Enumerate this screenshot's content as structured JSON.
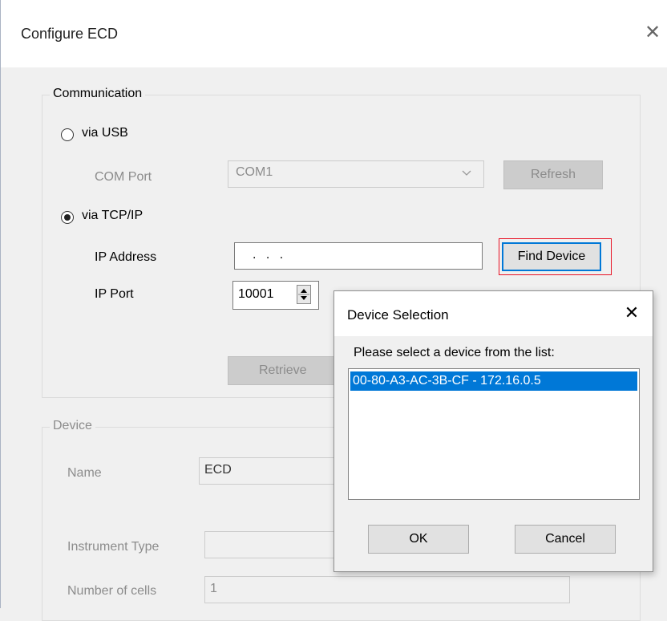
{
  "window": {
    "title": "Configure ECD"
  },
  "communication": {
    "legend": "Communication",
    "via_usb_label": "via USB",
    "com_port_label": "COM Port",
    "com_port_value": "COM1",
    "refresh_label": "Refresh",
    "via_tcpip_label": "via TCP/IP",
    "ip_address_label": "IP Address",
    "ip_address_value": ". . .",
    "find_device_label": "Find Device",
    "ip_port_label": "IP Port",
    "ip_port_value": "10001",
    "retrieve_label": "Retrieve"
  },
  "device": {
    "legend": "Device",
    "name_label": "Name",
    "name_value": "ECD",
    "instrument_type_label": "Instrument Type",
    "instrument_type_value": "",
    "number_of_cells_label": "Number of cells",
    "number_of_cells_value": "1"
  },
  "device_selection": {
    "title": "Device Selection",
    "prompt": "Please select a device from the list:",
    "items": [
      "00-80-A3-AC-3B-CF - 172.16.0.5"
    ],
    "ok_label": "OK",
    "cancel_label": "Cancel"
  },
  "colors": {
    "highlight": "#0078d7",
    "focus_outline": "#e81123"
  }
}
